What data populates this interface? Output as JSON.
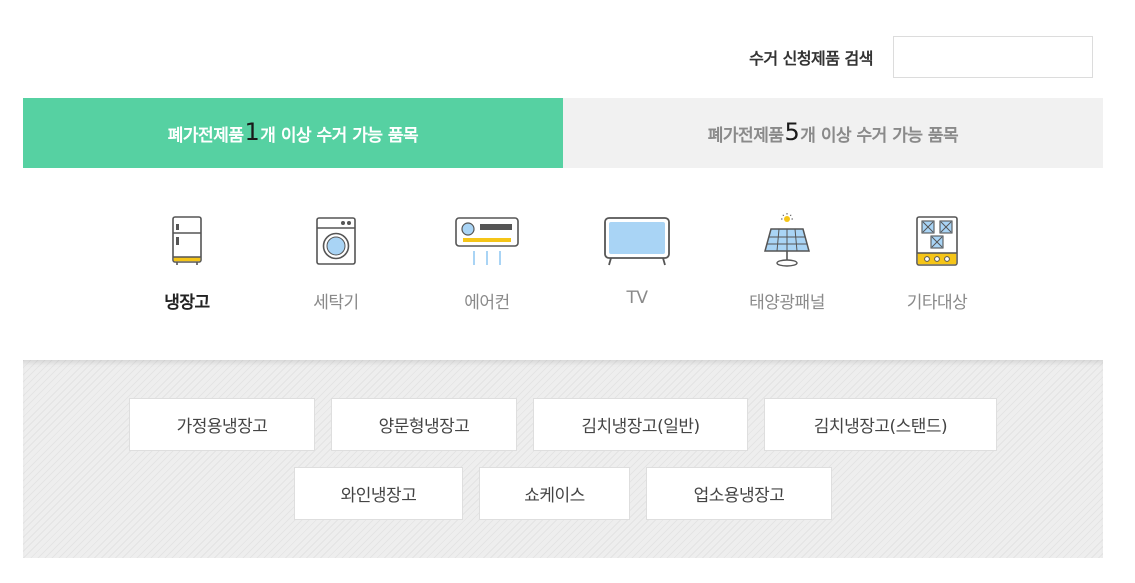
{
  "search": {
    "label": "수거 신청제품 검색",
    "value": "",
    "placeholder": ""
  },
  "tabs": [
    {
      "prefix": "폐가전제품 ",
      "number": "1",
      "suffix": "개 이상 수거 가능 품목",
      "active": true
    },
    {
      "prefix": "폐가전제품 ",
      "number": "5",
      "suffix": "개 이상 수거 가능 품목",
      "active": false
    }
  ],
  "categories": [
    {
      "label": "냉장고",
      "icon": "refrigerator-icon",
      "selected": true
    },
    {
      "label": "세탁기",
      "icon": "washing-machine-icon",
      "selected": false
    },
    {
      "label": "에어컨",
      "icon": "air-conditioner-icon",
      "selected": false
    },
    {
      "label": "TV",
      "icon": "tv-icon",
      "selected": false
    },
    {
      "label": "태양광패널",
      "icon": "solar-panel-icon",
      "selected": false
    },
    {
      "label": "기타대상",
      "icon": "stove-icon",
      "selected": false
    }
  ],
  "subcategories": [
    {
      "label": "가정용냉장고"
    },
    {
      "label": "양문형냉장고"
    },
    {
      "label": "김치냉장고(일반)"
    },
    {
      "label": "김치냉장고(스탠드)"
    },
    {
      "label": "와인냉장고"
    },
    {
      "label": "쇼케이스"
    },
    {
      "label": "업소용냉장고"
    }
  ],
  "colors": {
    "accent": "#56d1a2",
    "accent_highlight": "#7fe3bb",
    "tab_inactive_bg": "#f1f1f1",
    "panel_bg": "#eeeeee"
  }
}
